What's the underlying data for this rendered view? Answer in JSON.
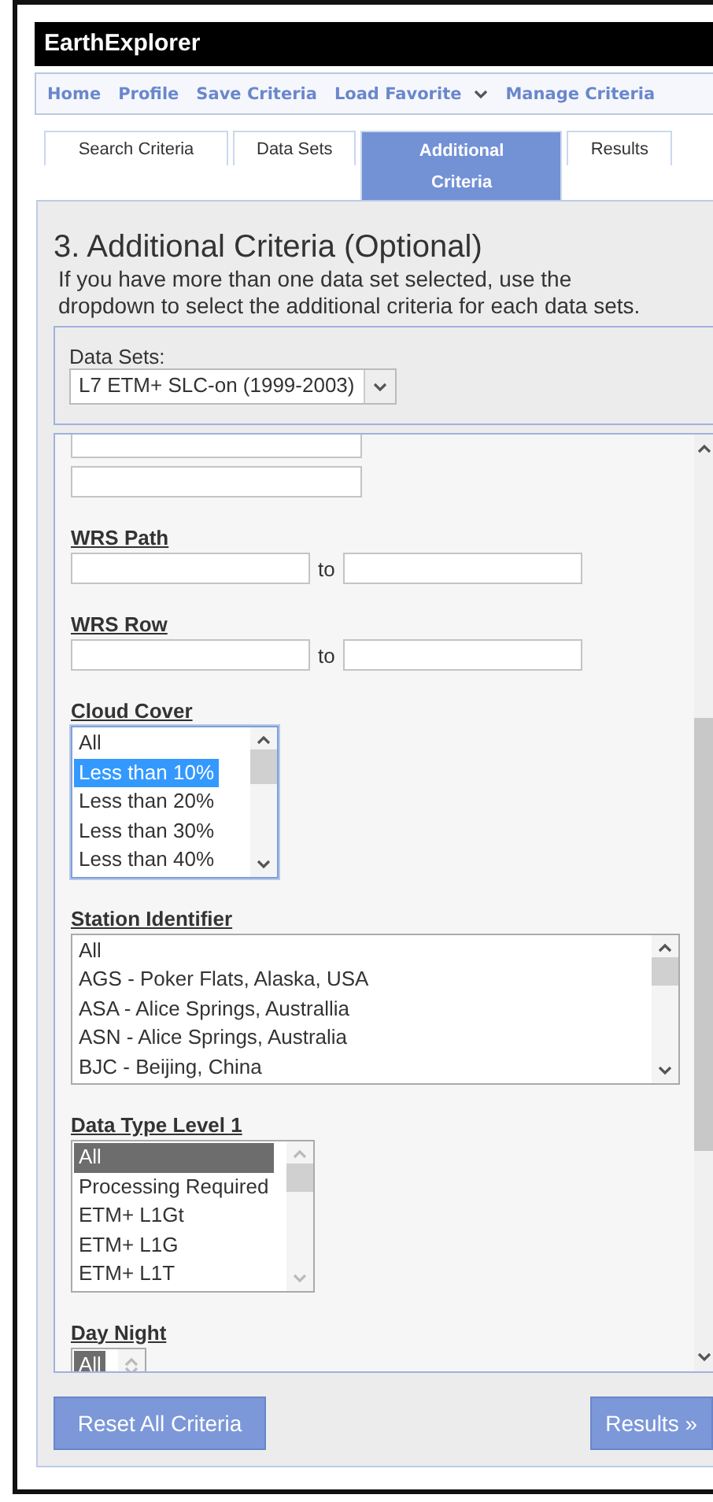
{
  "app": {
    "title": "EarthExplorer"
  },
  "nav": [
    {
      "label": "Home",
      "dropdown": false
    },
    {
      "label": "Profile",
      "dropdown": false
    },
    {
      "label": "Save Criteria",
      "dropdown": false
    },
    {
      "label": "Load Favorite",
      "dropdown": true
    },
    {
      "label": "Manage Criteria",
      "dropdown": false
    }
  ],
  "tabs": [
    {
      "label": "Search Criteria",
      "selected": false
    },
    {
      "label": "Data Sets",
      "selected": false
    },
    {
      "label": "Additional Criteria",
      "selected": true
    },
    {
      "label": "Results",
      "selected": false
    }
  ],
  "panel": {
    "heading": "3. Additional Criteria (Optional)",
    "description": "If you have more than one data set selected, use the dropdown to select the additional criteria for each data sets."
  },
  "dataset_picker": {
    "label": "Data Sets:",
    "value": "L7 ETM+ SLC-on (1999-2003)"
  },
  "criteria": [
    {
      "kind": "stack",
      "fields": [
        {
          "kind": "text"
        },
        {
          "kind": "text"
        }
      ]
    },
    {
      "kind": "range",
      "label": "WRS Path",
      "connector": "to"
    },
    {
      "kind": "range",
      "label": "WRS Row",
      "connector": "to"
    },
    {
      "kind": "listbox",
      "label": "Cloud Cover",
      "focused": true,
      "wide": false,
      "options": [
        {
          "label": "All",
          "selected": false
        },
        {
          "label": "Less than 10%",
          "selected": true
        },
        {
          "label": "Less than 20%",
          "selected": false
        },
        {
          "label": "Less than 30%",
          "selected": false
        },
        {
          "label": "Less than 40%",
          "selected": false
        }
      ]
    },
    {
      "kind": "listbox",
      "label": "Station Identifier",
      "focused": false,
      "wide": true,
      "options": [
        {
          "label": "All",
          "selected": false
        },
        {
          "label": "AGS - Poker Flats, Alaska, USA",
          "selected": false
        },
        {
          "label": "ASA - Alice Springs, Australlia",
          "selected": false
        },
        {
          "label": "ASN - Alice Springs, Australia",
          "selected": false
        },
        {
          "label": "BJC - Beijing, China",
          "selected": false
        }
      ]
    },
    {
      "kind": "listbox",
      "label": "Data Type Level 1",
      "focused": false,
      "wide": false,
      "options": [
        {
          "label": "All",
          "selected": true
        },
        {
          "label": "Processing Required",
          "selected": false
        },
        {
          "label": "ETM+ L1Gt",
          "selected": false
        },
        {
          "label": "ETM+ L1G",
          "selected": false
        },
        {
          "label": "ETM+ L1T",
          "selected": false
        }
      ]
    },
    {
      "kind": "listbox",
      "label": "Day Night",
      "focused": false,
      "wide": false,
      "options": [
        {
          "label": "All",
          "selected": true
        }
      ]
    }
  ],
  "buttons": [
    {
      "label": "Reset All Criteria"
    },
    {
      "label": "Results »"
    }
  ]
}
